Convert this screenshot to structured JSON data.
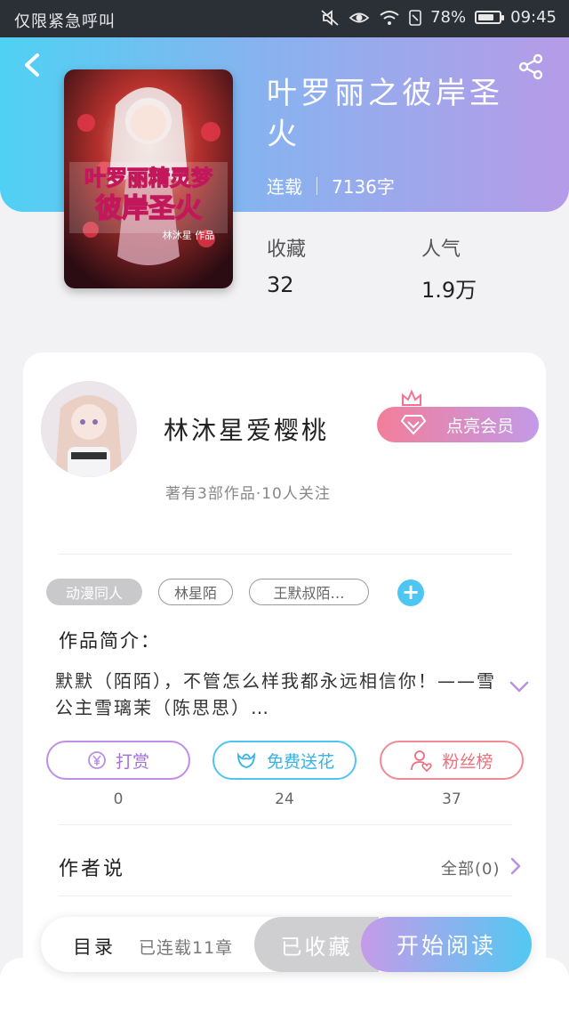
{
  "status_bar": {
    "left_text": "仅限紧急呼叫",
    "battery": "78%",
    "time": "09:45"
  },
  "book": {
    "title": "叶罗丽之彼岸圣火",
    "state": "连载",
    "words": "7136字",
    "cover_title": "叶罗丽精灵梦 彼岸圣火",
    "cover_author": "林沐星 作品",
    "stats": [
      {
        "label": "收藏",
        "value": "32"
      },
      {
        "label": "人气",
        "value": "1.9万"
      }
    ]
  },
  "author": {
    "name": "林沐星爱樱桃",
    "sub": "著有3部作品·10人关注",
    "vip_label": "点亮会员"
  },
  "tags": [
    "动漫同人",
    "林星陌",
    "王默叔陌…"
  ],
  "intro": {
    "title": "作品简介：",
    "text": "默默（陌陌），不管怎么样我都永远相信你！——雪公主雪璃茉（陈思思）…"
  },
  "actions": [
    {
      "label": "打赏",
      "count": "0"
    },
    {
      "label": "免费送花",
      "count": "24"
    },
    {
      "label": "粉丝榜",
      "count": "37"
    }
  ],
  "author_says": {
    "title": "作者说",
    "all": "全部(0)"
  },
  "bottom": {
    "catalog": "目录",
    "serial": "已连载11章",
    "fav": "已收藏",
    "read": "开始阅读"
  },
  "colors": {
    "hero_start": "#4fd1f3",
    "hero_end": "#b69be8",
    "accent_cyan": "#4fc6f1",
    "accent_purple": "#c08ee8",
    "accent_pink": "#f08a94"
  }
}
